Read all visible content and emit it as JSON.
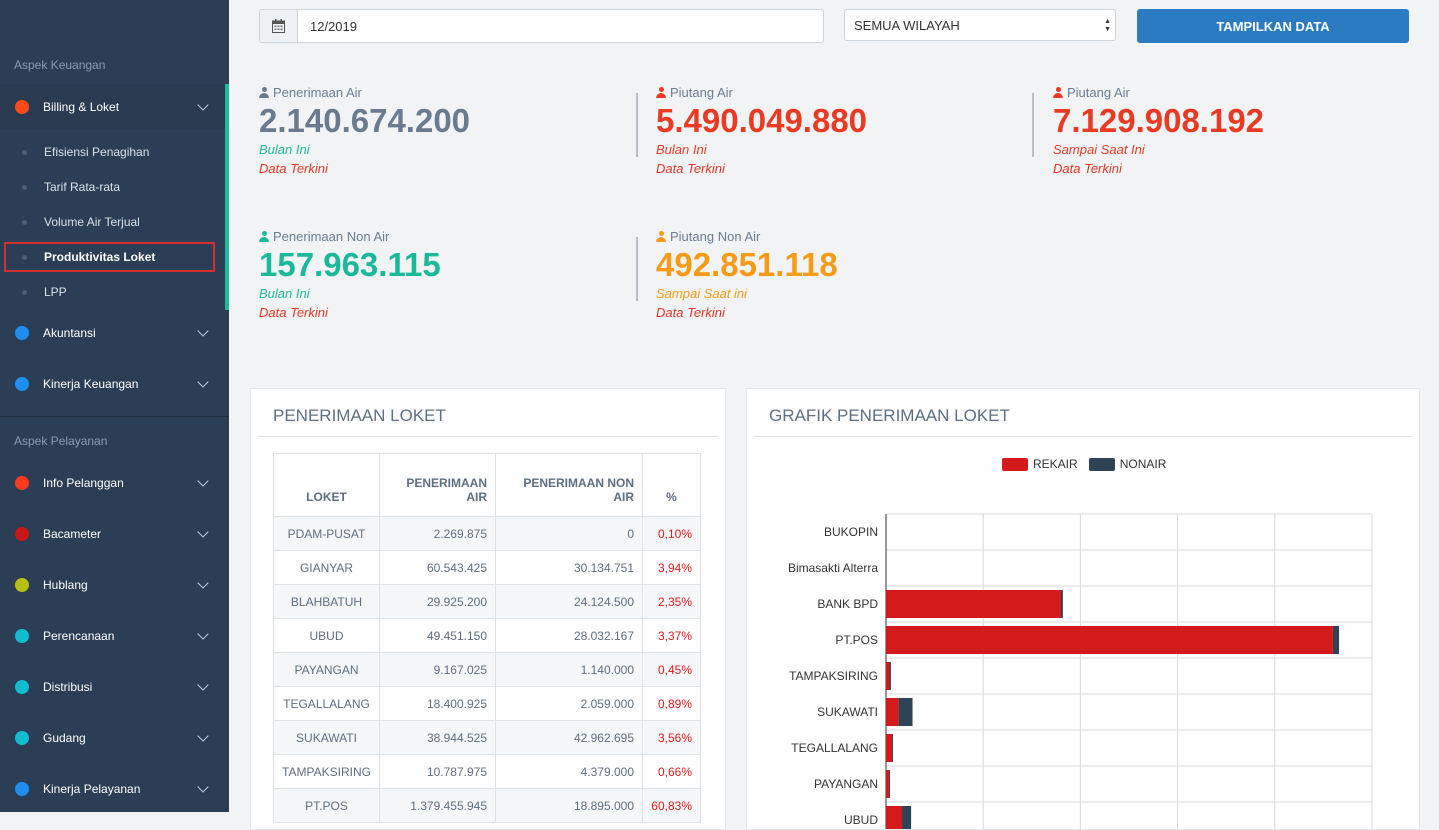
{
  "sidebar": {
    "sections": [
      {
        "title": "Aspek Keuangan"
      },
      {
        "title": "Aspek Pelayanan"
      }
    ],
    "finance_items": [
      {
        "label": "Billing & Loket",
        "color": "#ff4a1a"
      },
      {
        "label": "Akuntansi",
        "color": "#1e8ff0"
      },
      {
        "label": "Kinerja Keuangan",
        "color": "#1e8ff0"
      }
    ],
    "billing_sub": [
      {
        "label": "Efisiensi Penagihan"
      },
      {
        "label": "Tarif Rata-rata"
      },
      {
        "label": "Volume Air Terjual"
      },
      {
        "label": "Produktivitas Loket"
      },
      {
        "label": "LPP"
      }
    ],
    "service_items": [
      {
        "label": "Info Pelanggan",
        "color": "#ff3b1f"
      },
      {
        "label": "Bacameter",
        "color": "#c91616"
      },
      {
        "label": "Hublang",
        "color": "#b7bf11"
      },
      {
        "label": "Perencanaan",
        "color": "#12bcd0"
      },
      {
        "label": "Distribusi",
        "color": "#12bcd0"
      },
      {
        "label": "Gudang",
        "color": "#12bcd0"
      },
      {
        "label": "Kinerja Pelayanan",
        "color": "#1e8ff0"
      }
    ]
  },
  "filters": {
    "period": "12/2019",
    "region": "SEMUA WILAYAH",
    "show_button": "TAMPILKAN DATA"
  },
  "stats": [
    {
      "label": "Penerimaan Air",
      "value": "2.140.674.200",
      "sub1": "Bulan Ini",
      "sub2": "Data Terkini",
      "color": "#6b7b8f"
    },
    {
      "label": "Piutang Air",
      "value": "5.490.049.880",
      "sub1": "Bulan Ini",
      "sub2": "Data Terkini",
      "color": "#ea3a24"
    },
    {
      "label": "Piutang Air",
      "value": "7.129.908.192",
      "sub1": "Sampai Saat Ini",
      "sub2": "Data Terkini",
      "color": "#ea3a24"
    },
    {
      "label": "Penerimaan Non Air",
      "value": "157.963.115",
      "sub1": "Bulan Ini",
      "sub2": "Data Terkini",
      "color": "#1ab99a"
    },
    {
      "label": "Piutang Non Air",
      "value": "492.851.118",
      "sub1": "Sampai Saat ini",
      "sub2": "Data Terkini",
      "color": "#f79a16"
    }
  ],
  "table_card": {
    "title": "PENERIMAAN LOKET",
    "headers": [
      "LOKET",
      "PENERIMAAN AIR",
      "PENERIMAAN NON AIR",
      "%"
    ],
    "rows": [
      [
        "PDAM-PUSAT",
        "2.269.875",
        "0",
        "0,10%"
      ],
      [
        "GIANYAR",
        "60.543.425",
        "30.134.751",
        "3,94%"
      ],
      [
        "BLAHBATUH",
        "29.925.200",
        "24.124.500",
        "2,35%"
      ],
      [
        "UBUD",
        "49.451.150",
        "28.032.167",
        "3,37%"
      ],
      [
        "PAYANGAN",
        "9.167.025",
        "1.140.000",
        "0,45%"
      ],
      [
        "TEGALLALANG",
        "18.400.925",
        "2.059.000",
        "0,89%"
      ],
      [
        "SUKAWATI",
        "38.944.525",
        "42.962.695",
        "3,56%"
      ],
      [
        "TAMPAKSIRING",
        "10.787.975",
        "4.379.000",
        "0,66%"
      ],
      [
        "PT.POS",
        "1.379.455.945",
        "18.895.000",
        "60,83%"
      ]
    ]
  },
  "chart_card": {
    "title": "GRAFIK PENERIMAAN LOKET"
  },
  "chart_data": {
    "type": "bar",
    "orientation": "horizontal",
    "stacked": true,
    "title": "GRAFIK PENERIMAAN LOKET",
    "categories": [
      "BUKOPIN",
      "Bimasakti Alterra",
      "BANK BPD",
      "PT.POS",
      "TAMPAKSIRING",
      "SUKAWATI",
      "TEGALLALANG",
      "PAYANGAN",
      "UBUD"
    ],
    "series": [
      {
        "name": "REKAIR",
        "color": "#d41a1a",
        "values": [
          0,
          0,
          540000000,
          1379455945,
          10787975,
          38944525,
          18400925,
          9167025,
          49451150
        ]
      },
      {
        "name": "NONAIR",
        "color": "#2e4356",
        "values": [
          0,
          0,
          6000000,
          18895000,
          4379000,
          42962695,
          2059000,
          1140000,
          28032167
        ]
      }
    ],
    "xlim": [
      0,
      1500000000
    ],
    "legend_position": "top",
    "grid": true
  }
}
